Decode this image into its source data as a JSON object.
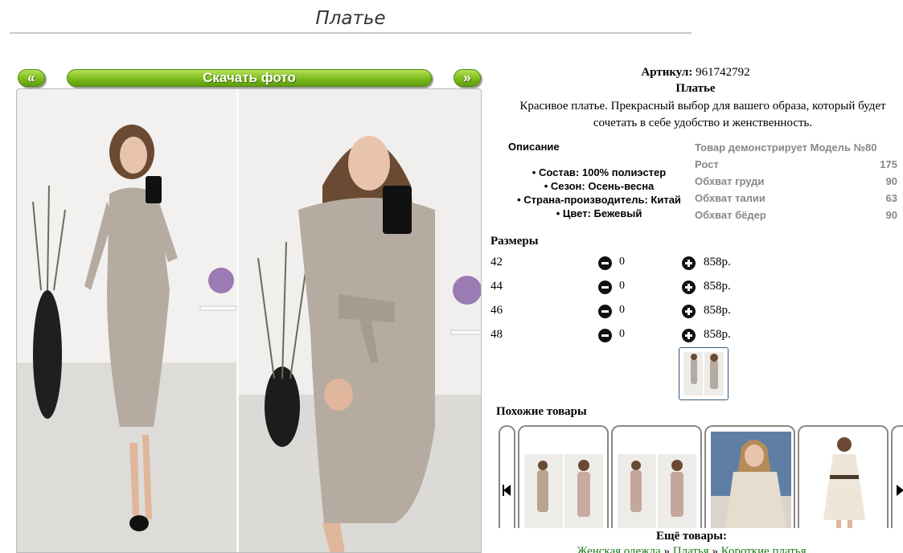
{
  "page": {
    "title": "Платье"
  },
  "gallery": {
    "prev_label": "«",
    "download_label": "Скачать фото",
    "next_label": "»"
  },
  "product": {
    "article_label": "Артикул:",
    "article_value": "961742792",
    "name": "Платье",
    "description": "Красивое платье. Прекрасный выбор для вашего образа, который будет сочетать в себе удобство и женственность."
  },
  "details": {
    "heading": "Описание",
    "items": [
      "Состав: 100% полиэстер",
      "Сезон: Осень-весна",
      "Страна-производитель: Китай",
      "Цвет: Бежевый"
    ]
  },
  "model": {
    "title": "Товар демонстрирует Модель №80",
    "rows": [
      {
        "label": "Рост",
        "value": "175"
      },
      {
        "label": "Обхват груди",
        "value": "90"
      },
      {
        "label": "Обхват талии",
        "value": "63"
      },
      {
        "label": "Обхват бёдер",
        "value": "90"
      }
    ]
  },
  "sizes": {
    "heading": "Размеры",
    "rows": [
      {
        "size": "42",
        "qty": "0",
        "price": "858р."
      },
      {
        "size": "44",
        "qty": "0",
        "price": "858р."
      },
      {
        "size": "46",
        "qty": "0",
        "price": "858р."
      },
      {
        "size": "48",
        "qty": "0",
        "price": "858р."
      }
    ]
  },
  "similar": {
    "heading": "Похожие товары"
  },
  "more": {
    "heading": "Ещё товары:",
    "crumbs": [
      "Женская одежда",
      "Платья",
      "Короткие платья"
    ],
    "separator": "»"
  },
  "colors": {
    "accent_green": "#7cbc1c",
    "dress_beige": "#b5aba0",
    "link_green": "#1b7a1b"
  }
}
